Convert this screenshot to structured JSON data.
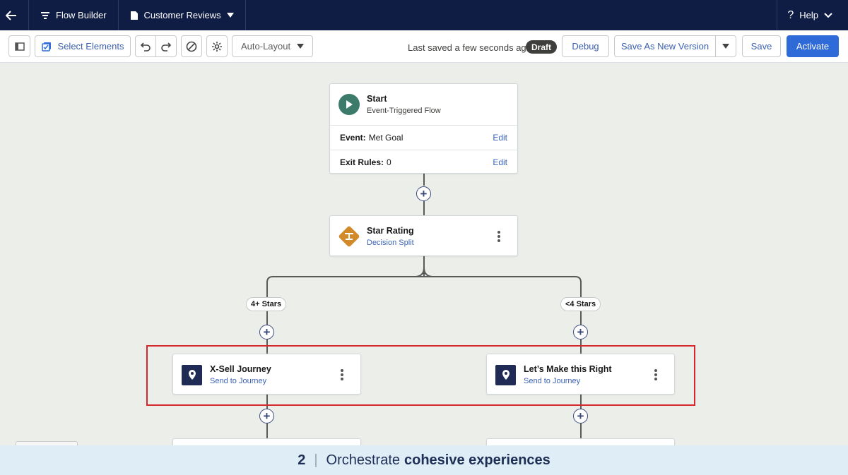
{
  "nav": {
    "app_label": "Flow Builder",
    "flow_name": "Customer Reviews",
    "help_label": "Help"
  },
  "toolbar": {
    "select_elements": "Select Elements",
    "layout_mode": "Auto-Layout",
    "saved_status": "Last saved a few seconds ago",
    "status_badge": "Draft",
    "debug": "Debug",
    "save_new_version": "Save As New Version",
    "save": "Save",
    "activate": "Activate"
  },
  "start": {
    "title": "Start",
    "subtitle": "Event-Triggered Flow",
    "event_label": "Event:",
    "event_value": "Met Goal",
    "exit_label": "Exit Rules:",
    "exit_value": "0",
    "edit": "Edit"
  },
  "decision": {
    "title": "Star Rating",
    "subtitle": "Decision Split"
  },
  "branches": [
    {
      "label": "4+ Stars",
      "title": "X-Sell Journey",
      "subtitle": "Send to Journey"
    },
    {
      "label": "<4 Stars",
      "title": "Let’s Make this Right",
      "subtitle": "Send to Journey"
    }
  ],
  "banner": {
    "number": "2",
    "separator": "|",
    "text": "Orchestrate",
    "emphasis": "cohesive experiences"
  },
  "colors": {
    "nav_bg": "#0f1d45",
    "accent": "#2e6bd8",
    "start_icon": "#3c7a6a",
    "decision_icon": "#d2892a",
    "journey_icon": "#1f2a55",
    "highlight": "#d6262e"
  }
}
